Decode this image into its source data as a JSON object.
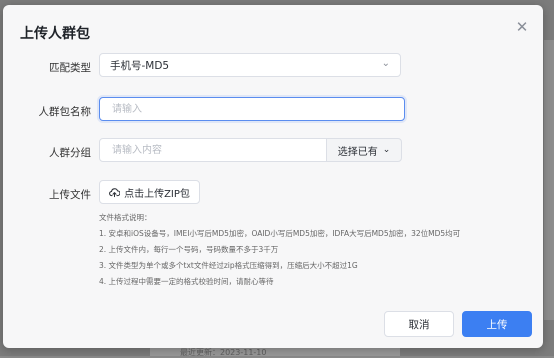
{
  "background": {
    "footer_text": "最近更新：2023-11-10"
  },
  "dialog": {
    "title": "上传人群包",
    "close_icon": "close-icon",
    "match_type": {
      "label": "匹配类型",
      "value": "手机号-MD5"
    },
    "package_name": {
      "label": "人群包名称",
      "placeholder": "请输入",
      "value": ""
    },
    "group": {
      "label": "人群分组",
      "placeholder": "请输入内容",
      "select_label": "选择已有"
    },
    "upload": {
      "label": "上传文件",
      "button_label": "点击上传ZIP包"
    },
    "notes": [
      "文件格式说明：",
      "1. 安卓和iOS设备号，IMEI小写后MD5加密，OAID小写后MD5加密，IDFA大写后MD5加密，32位MD5均可",
      "2. 上传文件内，每行一个号码，号码数量不多于3千万",
      "3. 文件类型为单个或多个txt文件经过zip格式压缩得到，压缩后大小不超过1G",
      "4. 上传过程中需要一定的格式校验时间，请耐心等待"
    ],
    "buttons": {
      "cancel": "取消",
      "submit": "上传"
    },
    "accent_color": "#3c7ff2"
  }
}
